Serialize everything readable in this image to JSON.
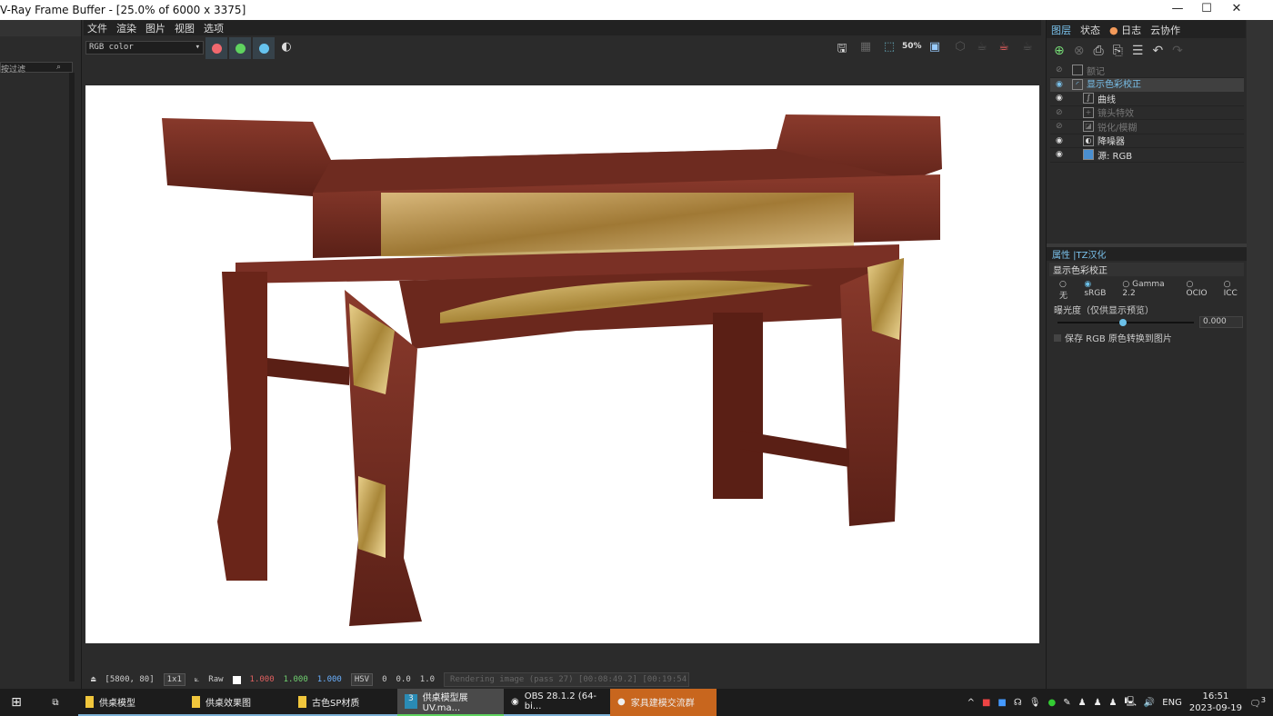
{
  "window": {
    "title": "V-Ray Frame Buffer - [25.0% of 6000 x 3375]",
    "minimize": "—",
    "maximize": "☐",
    "close": "✕"
  },
  "left_panel": {
    "filter_placeholder": "按过滤"
  },
  "menu": [
    "文件",
    "渲染",
    "图片",
    "视图",
    "选项"
  ],
  "toolbar": {
    "channel": "RGB color",
    "colors": {
      "red": "#f0686e",
      "green": "#5fd35f",
      "blue": "#66c4f0"
    },
    "zoom_badge": "50%"
  },
  "status": {
    "coords": "[5800, 80]",
    "ratio": "1x1",
    "mode": "Raw",
    "r": "1.000",
    "g": "1.000",
    "b": "1.000",
    "colorspace": "HSV",
    "h": "0",
    "s": "0.0",
    "v": "1.0",
    "progress": "Rendering image (pass 27) [00:08:49.2] [00:19:54.6 est]"
  },
  "right_panel": {
    "tabs": [
      "图层",
      "状态",
      "日志",
      "云协作"
    ],
    "layers": [
      {
        "label": "额记",
        "visible": false,
        "indent": 0
      },
      {
        "label": "显示色彩校正",
        "visible": true,
        "indent": 0,
        "selected": true
      },
      {
        "label": "曲线",
        "visible": true,
        "indent": 1
      },
      {
        "label": "镜头特效",
        "visible": false,
        "indent": 1
      },
      {
        "label": "锐化/模糊",
        "visible": false,
        "indent": 1
      },
      {
        "label": "降噪器",
        "visible": true,
        "indent": 1
      },
      {
        "label": "源:  RGB",
        "visible": true,
        "indent": 1
      }
    ],
    "props_title": "属性 |TZ汉化",
    "props_name": "显示色彩校正",
    "radio": [
      "无",
      "sRGB",
      "Gamma 2.2",
      "OCIO",
      "ICC"
    ],
    "radio_selected": "sRGB",
    "exposure_label": "曝光度（仅供显示预览）",
    "exposure_value": "0.000",
    "save_checkbox": "保存 RGB 原色转换到图片"
  },
  "taskbar": {
    "items": [
      "供桌模型",
      "供桌效果图",
      "古色SP材质",
      "供桌模型展UV.ma...",
      "OBS 28.1.2 (64-bi...",
      "家具建模交流群"
    ],
    "lang": "ENG",
    "time": "16:51",
    "date": "2023-09-19",
    "notifications": "3"
  }
}
